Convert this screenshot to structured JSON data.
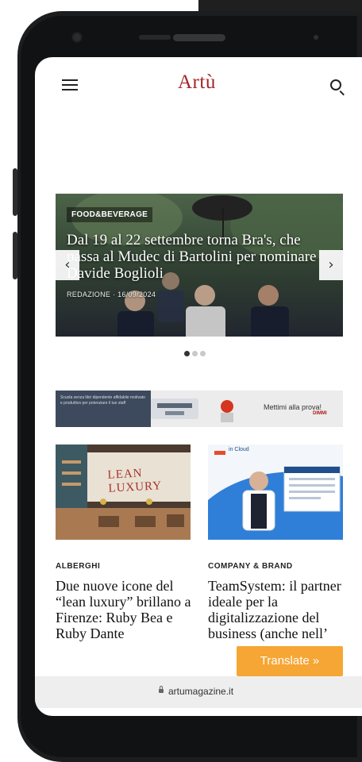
{
  "header": {
    "logo_text": "Artù",
    "menu_icon": "hamburger-menu-icon",
    "search_icon": "search-icon",
    "brand_color": "#a3242a"
  },
  "carousel": {
    "category": "FOOD&BEVERAGE",
    "headline": "Dal 19 al 22 settembre torna Bra's, che passa al Mudec di Bartolini per nominare Davide Boglioli",
    "author": "REDAZIONE",
    "date": "16/09/2024",
    "prev_label": "‹",
    "next_label": "›",
    "active_slide": 1,
    "slide_count": 3
  },
  "banner": {
    "left_text": "Scuola senza libri dipendente affidabile motivato e produttivo per potenziare il tuo staff",
    "cta_text": "Mettimi alla prova!",
    "brand_text": "DIMMI"
  },
  "articles": [
    {
      "category": "ALBERGHI",
      "title": "Due nuove icone del “lean luxury” brillano a Firenze: Ruby Bea e Ruby Dante",
      "sign_text": "LEAN LUXURY"
    },
    {
      "category": "COMPANY & BRAND",
      "title": "TeamSystem: il partner ideale per la digitalizzazione del business (anche nell’",
      "logo_text": "in Cloud"
    }
  ],
  "translate_button": {
    "label": "Translate »",
    "color": "#f6a634"
  },
  "browser": {
    "url": "artumagazine.it",
    "lock_icon": "lock-icon"
  }
}
